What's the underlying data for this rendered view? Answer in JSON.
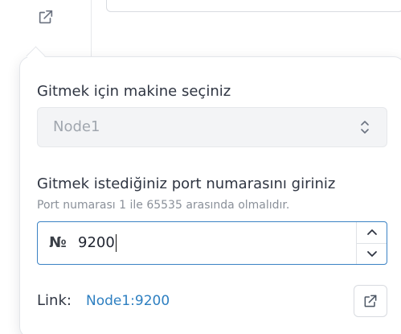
{
  "rail": {
    "icon": "external-link-icon"
  },
  "form": {
    "machine_label": "Gitmek için makine seçiniz",
    "machine_value": "Node1",
    "port_label": "Gitmek istediğiniz port numarasını giriniz",
    "port_hint": "Port numarası 1 ile 65535 arasında olmalıdır.",
    "port_prefix": "№",
    "port_value": "9200",
    "link_label": "Link:",
    "link_value": "Node1:9200"
  },
  "icons": {
    "select": "chevron-up-down-icon",
    "step_up": "chevron-up-icon",
    "step_down": "chevron-down-icon",
    "open": "external-link-icon"
  },
  "colors": {
    "accent": "#3b82c4",
    "link": "#2d7fc1",
    "text": "#2f3542",
    "muted": "#8a9099"
  }
}
